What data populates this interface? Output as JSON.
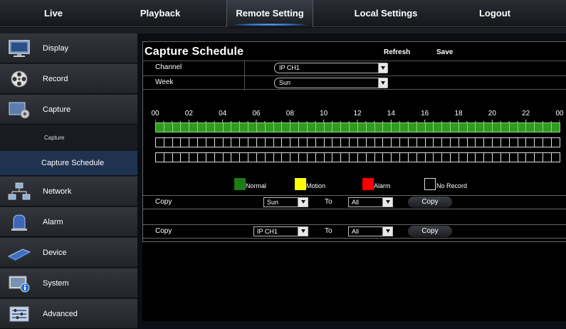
{
  "nav": {
    "tabs": [
      {
        "label": "Live"
      },
      {
        "label": "Playback"
      },
      {
        "label": "Remote Setting"
      },
      {
        "label": "Local Settings"
      },
      {
        "label": "Logout"
      }
    ],
    "active": "Remote Setting"
  },
  "sidebar": {
    "items": [
      {
        "label": "Display",
        "icon": "monitor-icon"
      },
      {
        "label": "Record",
        "icon": "film-reel-icon"
      },
      {
        "label": "Capture",
        "icon": "capture-gear-icon"
      },
      {
        "label": "Network",
        "icon": "network-icon"
      },
      {
        "label": "Alarm",
        "icon": "alarm-icon"
      },
      {
        "label": "Device",
        "icon": "device-icon"
      },
      {
        "label": "System",
        "icon": "system-info-icon"
      },
      {
        "label": "Advanced",
        "icon": "advanced-icon"
      }
    ],
    "subitems": [
      {
        "label": "Capture"
      },
      {
        "label": "Capture Schedule"
      }
    ]
  },
  "main": {
    "title": "Capture Schedule",
    "refresh": "Refresh",
    "save": "Save",
    "channel_label": "Channel",
    "channel_value": "IP CH1",
    "week_label": "Week",
    "week_value": "Sun",
    "hours": [
      "00",
      "02",
      "04",
      "06",
      "08",
      "10",
      "12",
      "14",
      "16",
      "18",
      "20",
      "22",
      "00"
    ],
    "legend": [
      {
        "label": "Normal",
        "color": "#1e7a12"
      },
      {
        "label": "Motion",
        "color": "#ffff00"
      },
      {
        "label": "Alarm",
        "color": "#ff0000"
      },
      {
        "label": "No Record",
        "color": "#000000"
      }
    ],
    "copy1": {
      "label": "Copy",
      "from": "Sun",
      "to_label": "To",
      "to": "All",
      "button": "Copy"
    },
    "copy2": {
      "label": "Copy",
      "from": "IP CH1",
      "to_label": "To",
      "to": "All",
      "button": "Copy"
    }
  }
}
